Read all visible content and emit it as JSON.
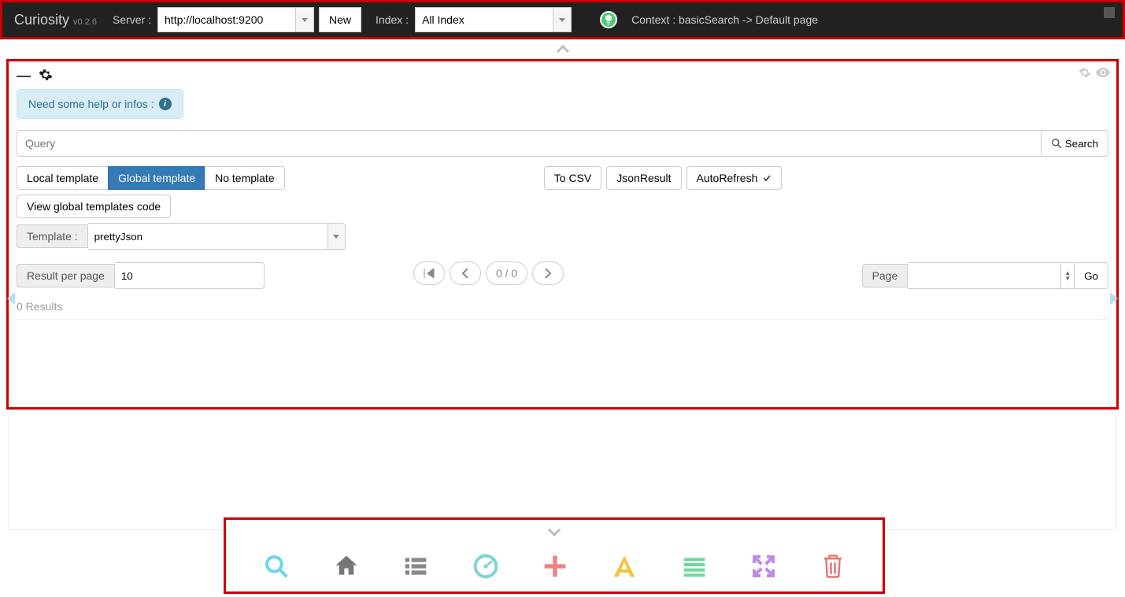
{
  "app": {
    "name": "Curiosity",
    "version": "v0.2.6"
  },
  "nav": {
    "server_label": "Server :",
    "server_value": "http://localhost:9200",
    "new_button": "New",
    "index_label": "Index :",
    "index_value": "All Index",
    "context_label": "Context : basicSearch -> Default page"
  },
  "help": {
    "text": "Need some help or infos :"
  },
  "query": {
    "placeholder": "Query",
    "search_button": "Search"
  },
  "template_tabs": {
    "local": "Local template",
    "global": "Global template",
    "none": "No template",
    "view_code": "View global templates code"
  },
  "export": {
    "to_csv": "To CSV",
    "json_result": "JsonResult",
    "autorefresh": "AutoRefresh"
  },
  "template": {
    "label": "Template :",
    "value": "prettyJson"
  },
  "rpp": {
    "label": "Result per page",
    "value": "10"
  },
  "pager": {
    "position": "0 / 0"
  },
  "page_jump": {
    "label": "Page",
    "go": "Go"
  },
  "results": {
    "count_text": "0 Results"
  },
  "bottom_icons": {
    "search": "search",
    "home": "home",
    "list": "list",
    "gauge": "dashboard",
    "plus": "add",
    "font": "text",
    "align": "align",
    "expand": "fullscreen",
    "trash": "delete"
  },
  "colors": {
    "highlight_border": "#c00",
    "primary": "#337ab7",
    "info_bg": "#d9edf7",
    "search_icon": "#6ad7e5",
    "home_icon": "#777",
    "list_icon": "#888",
    "gauge_icon": "#7fd3d3",
    "plus_icon": "#f08080",
    "font_icon": "#f5c23e",
    "align_icon": "#6fd89c",
    "expand_icon": "#c08be6",
    "trash_icon": "#e77471"
  }
}
